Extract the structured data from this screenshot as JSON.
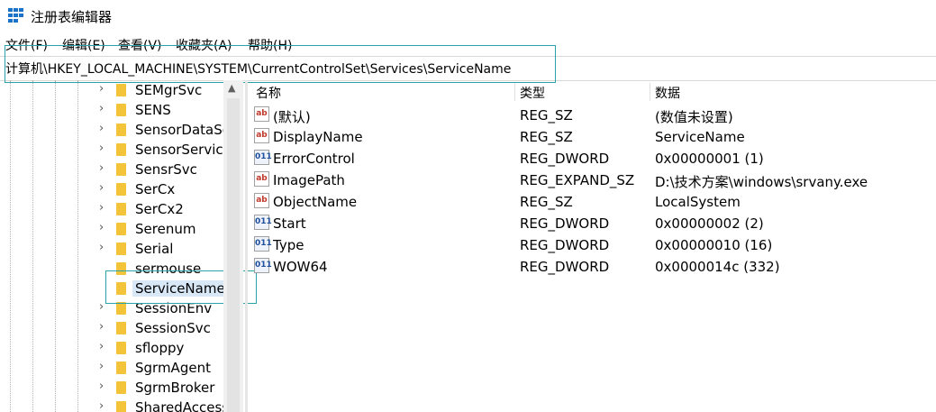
{
  "window": {
    "title": "注册表编辑器"
  },
  "menu": [
    "文件(F)",
    "编辑(E)",
    "查看(V)",
    "收藏夹(A)",
    "帮助(H)"
  ],
  "address": "计算机\\HKEY_LOCAL_MACHINE\\SYSTEM\\CurrentControlSet\\Services\\ServiceName",
  "tree": {
    "items": [
      {
        "label": "SEMgrSvc",
        "expandable": true
      },
      {
        "label": "SENS",
        "expandable": true
      },
      {
        "label": "SensorDataSe",
        "expandable": true
      },
      {
        "label": "SensorService",
        "expandable": true
      },
      {
        "label": "SensrSvc",
        "expandable": true
      },
      {
        "label": "SerCx",
        "expandable": true
      },
      {
        "label": "SerCx2",
        "expandable": true
      },
      {
        "label": "Serenum",
        "expandable": true
      },
      {
        "label": "Serial",
        "expandable": true
      },
      {
        "label": "sermouse",
        "expandable": false
      },
      {
        "label": "ServiceName",
        "expandable": false,
        "selected": true
      },
      {
        "label": "SessionEnv",
        "expandable": true
      },
      {
        "label": "SessionSvc",
        "expandable": true
      },
      {
        "label": "sfloppy",
        "expandable": true
      },
      {
        "label": "SgrmAgent",
        "expandable": true
      },
      {
        "label": "SgrmBroker",
        "expandable": true
      },
      {
        "label": "SharedAccess",
        "expandable": true
      }
    ]
  },
  "values": {
    "columns": {
      "name": "名称",
      "type": "类型",
      "data": "数据"
    },
    "rows": [
      {
        "icon": "string-value-icon",
        "name": "(默认)",
        "type": "REG_SZ",
        "data": "(数值未设置)"
      },
      {
        "icon": "string-value-icon",
        "name": "DisplayName",
        "type": "REG_SZ",
        "data": "ServiceName"
      },
      {
        "icon": "binary-value-icon",
        "name": "ErrorControl",
        "type": "REG_DWORD",
        "data": "0x00000001 (1)"
      },
      {
        "icon": "string-value-icon",
        "name": "ImagePath",
        "type": "REG_EXPAND_SZ",
        "data": "D:\\技术方案\\windows\\srvany.exe"
      },
      {
        "icon": "string-value-icon",
        "name": "ObjectName",
        "type": "REG_SZ",
        "data": "LocalSystem"
      },
      {
        "icon": "binary-value-icon",
        "name": "Start",
        "type": "REG_DWORD",
        "data": "0x00000002 (2)"
      },
      {
        "icon": "binary-value-icon",
        "name": "Type",
        "type": "REG_DWORD",
        "data": "0x00000010 (16)"
      },
      {
        "icon": "binary-value-icon",
        "name": "WOW64",
        "type": "REG_DWORD",
        "data": "0x0000014c (332)"
      }
    ]
  },
  "colors": {
    "highlight_box": "#2aa3a8",
    "folder": "#f3c43a",
    "app_icon": "#1a73c9"
  },
  "icon_glyphs": {
    "string": "ab",
    "binary": "011"
  }
}
